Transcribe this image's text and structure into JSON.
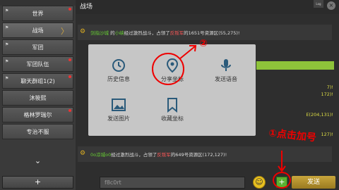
{
  "sidebar": {
    "items": [
      {
        "label": "世界",
        "dot": true
      },
      {
        "label": "战场",
        "active": true
      },
      {
        "label": "军团"
      },
      {
        "label": "军团队伍",
        "dot": true
      },
      {
        "label": "聊天群组1(2)",
        "dot": true
      },
      {
        "label": "沐筱熙"
      },
      {
        "label": "格林罗瑞尔",
        "dot": true
      },
      {
        "label": "专治不服"
      }
    ],
    "down_glyph": "⌄",
    "add_label": "+"
  },
  "header": {
    "title": "战场",
    "close_glyph": "×",
    "corner_badge": "Log"
  },
  "messages": [
    {
      "sender": "剑指沙城",
      "name": "小峡",
      "action": "经过激烈战斗，占领了",
      "target": "反叛军",
      "rest": "的1651号资源区(55,275)!"
    },
    {
      "sender": "0o凉城o0",
      "name": "",
      "action": "经过激烈战斗，占领了",
      "target": "反叛军",
      "rest": "的649号资源区(172,127)!"
    }
  ],
  "stubs": [
    "172)!",
    "7)!",
    "E(204,131)!",
    "127)!"
  ],
  "popup": {
    "items": [
      {
        "label": "历史信息",
        "icon": "history-icon"
      },
      {
        "label": "分享坐标",
        "icon": "location-pin-icon"
      },
      {
        "label": "发送语音",
        "icon": "microphone-icon"
      },
      {
        "label": "发送图片",
        "icon": "image-icon"
      },
      {
        "label": "收藏坐标",
        "icon": "bookmark-icon"
      }
    ]
  },
  "input": {
    "value": "f8c0rt"
  },
  "bottom": {
    "emoji_glyph": "☺",
    "plus_label": "+",
    "send_label": "发送"
  },
  "annotations": {
    "step1": "①点击加号",
    "step2": "②"
  },
  "colors": {
    "accent_green": "#5ab030",
    "send_gold": "#c9a63c",
    "annotation_red": "#e00000"
  }
}
